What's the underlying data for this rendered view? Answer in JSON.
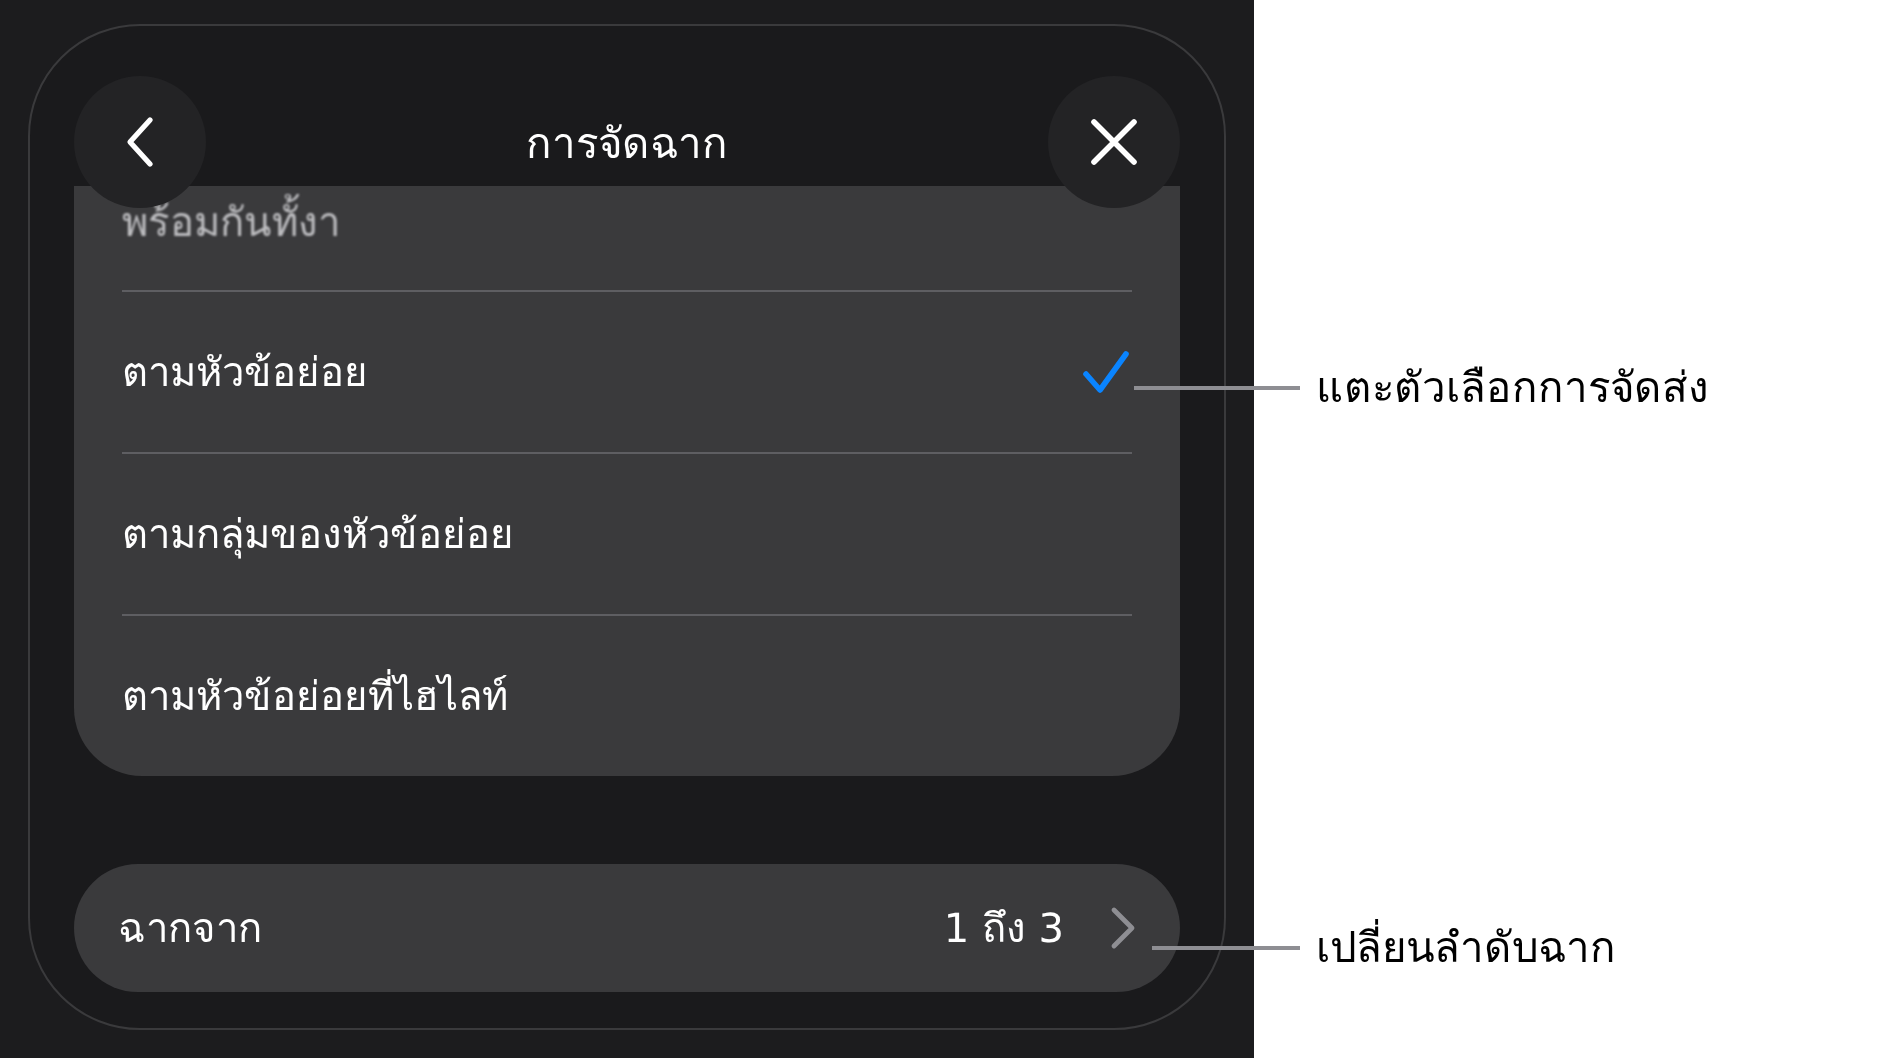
{
  "header": {
    "title": "การจัดฉาก"
  },
  "options": [
    {
      "label": "พร้อมกันทั้งา",
      "selected": false,
      "faded": true
    },
    {
      "label": "ตามหัวข้อย่อย",
      "selected": true,
      "faded": false
    },
    {
      "label": "ตามกลุ่มของหัวข้อย่อย",
      "selected": false,
      "faded": false
    },
    {
      "label": "ตามหัวข้อย่อยที่ไฮไลท์",
      "selected": false,
      "faded": false
    }
  ],
  "range_row": {
    "label": "ฉากจาก",
    "value": "1 ถึง 3"
  },
  "callouts": [
    {
      "text": "แตะตัวเลือกการจัดส่ง"
    },
    {
      "text": "เปลี่ยนลำดับฉาก"
    }
  ]
}
